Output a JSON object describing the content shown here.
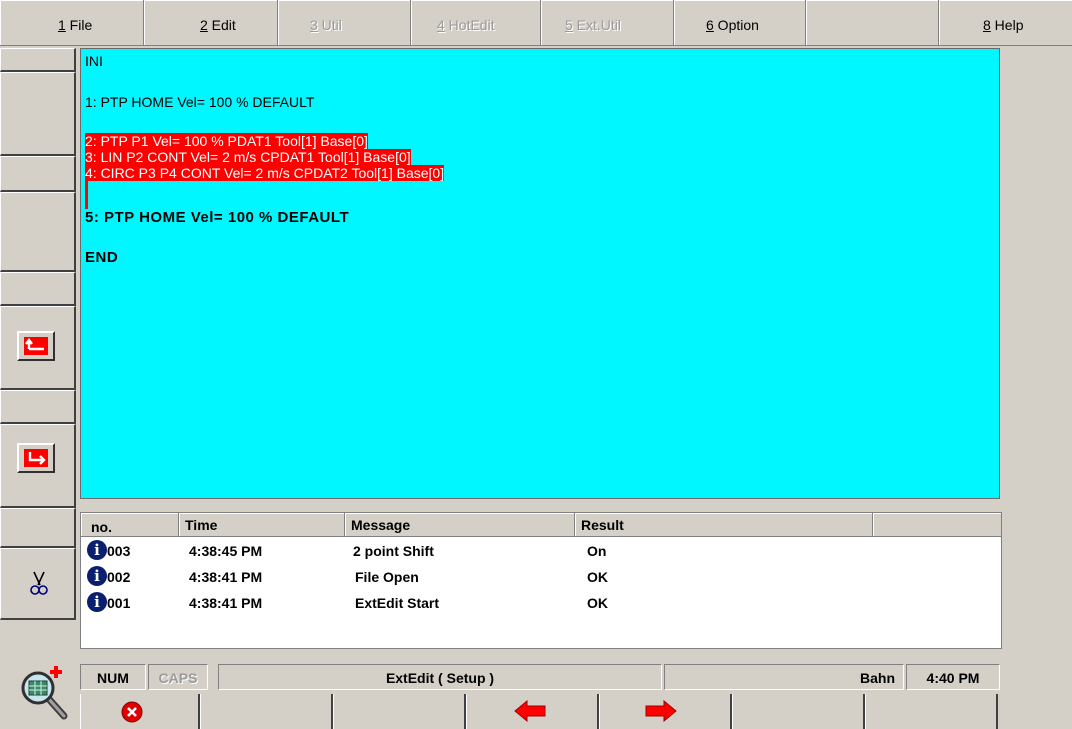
{
  "menu": [
    {
      "num": "1",
      "label": " File"
    },
    {
      "num": "2",
      "label": " Edit"
    },
    {
      "num": "3",
      "label": " Util"
    },
    {
      "num": "4",
      "label": " HotEdit"
    },
    {
      "num": "5",
      "label": " Ext.Util"
    },
    {
      "num": "6",
      "label": " Option"
    },
    {
      "num": "",
      "label": ""
    },
    {
      "num": "8",
      "label": " Help"
    }
  ],
  "editor": {
    "ini": "INI",
    "line1": "1: PTP HOME  Vel= 100 % DEFAULT",
    "line2": "2: PTP P1  Vel= 100 % PDAT1 Tool[1] Base[0]",
    "line3": "3: LIN P2 CONT Vel= 2 m/s CPDAT1 Tool[1] Base[0]",
    "line4": "4: CIRC P3 P4 CONT Vel= 2 m/s CPDAT2 Tool[1] Base[0]",
    "line5": "5: PTP HOME  Vel= 100 % DEFAULT",
    "end": "END"
  },
  "messages": {
    "headers": {
      "no": "no.",
      "time": "Time",
      "message": "Message",
      "result": "Result"
    },
    "rows": [
      {
        "icon": "i",
        "no": "003",
        "time": "4:38:45 PM",
        "message": " 2 point Shift",
        "result": "On"
      },
      {
        "icon": "i",
        "no": "002",
        "time": "4:38:41 PM",
        "message": "File Open",
        "result": "OK"
      },
      {
        "icon": "i",
        "no": "001",
        "time": "4:38:41 PM",
        "message": "ExtEdit Start",
        "result": "OK"
      }
    ]
  },
  "status": {
    "num": "NUM",
    "caps": "CAPS",
    "mode": "ExtEdit ( Setup )",
    "bahn": "Bahn",
    "clock": "4:40 PM"
  },
  "icons": {
    "up": "return-up-icon",
    "down": "return-down-icon",
    "scissors": "cut-icon",
    "zoom": "magnifier-icon",
    "cancel": "cancel-icon",
    "back": "arrow-left-icon",
    "forward": "arrow-right-icon"
  },
  "colors": {
    "editor_bg": "#00f7ff",
    "selection": "#ff0000",
    "chrome": "#d4d0c8"
  }
}
